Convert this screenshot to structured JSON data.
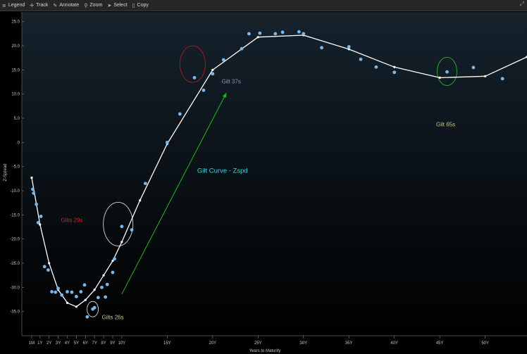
{
  "toolbar": {
    "items": [
      {
        "label": "Legend",
        "icon": "list-icon",
        "glyph": "≡"
      },
      {
        "label": "Track",
        "icon": "crosshair-icon",
        "glyph": "✛"
      },
      {
        "label": "Annotate",
        "icon": "pencil-icon",
        "glyph": "✎"
      },
      {
        "label": "Zoom",
        "icon": "magnifier-icon",
        "glyph": "⚲"
      },
      {
        "label": "Select",
        "icon": "cursor-icon",
        "glyph": "➤"
      },
      {
        "label": "Copy",
        "icon": "copy-icon",
        "glyph": "▯"
      }
    ]
  },
  "colors": {
    "background_top": "#15222c",
    "background_bottom": "#000000",
    "curve": "#ffffff",
    "points": "#7ab8ec",
    "arrow": "#1fb81f",
    "label_gilts29": "#d2282a",
    "label_gilt37": "#9a8cc4",
    "label_gilt65": "#c7c78a",
    "label_gilts26": "#c7c78a",
    "label_curve": "#3fd7e0",
    "circle_gilts29": "#d8d8d8",
    "circle_gilt37": "#b01a1a",
    "circle_gilt65": "#2fb12f",
    "circle_gilts26": "#d8d8d8"
  },
  "chart_data": {
    "type": "scatter",
    "title": "",
    "xlabel": "Years to Maturity",
    "ylabel": "Z-Spread",
    "xlim": [
      -1,
      54.6
    ],
    "ylim": [
      -40,
      27
    ],
    "grid": false,
    "x_tick_values": [
      0.083,
      1,
      2,
      3,
      4,
      5,
      6,
      7,
      8,
      9,
      10,
      15,
      20,
      25,
      30,
      35,
      40,
      45,
      50
    ],
    "x_tick_labels": [
      "1M",
      "1Y",
      "2Y",
      "3Y",
      "4Y",
      "5Y",
      "6Y",
      "7Y",
      "8Y",
      "9Y",
      "10Y",
      "15Y",
      "20Y",
      "25Y",
      "30Y",
      "35Y",
      "40Y",
      "45Y",
      "50Y"
    ],
    "y_tick_values": [
      25,
      20,
      15,
      10,
      5,
      0,
      -5,
      -10,
      -15,
      -20,
      -25,
      -30,
      -35
    ],
    "y_tick_labels": [
      "25.0",
      "20.0",
      "15.0",
      "10.0",
      "5.0",
      ".0",
      "-5.0",
      "-10.0",
      "-15.0",
      "-20.0",
      "-25.0",
      "-30.0",
      "-35.0"
    ],
    "series": [
      {
        "name": "Gilt Curve - Zspd",
        "kind": "line",
        "x": [
          0.083,
          0.6,
          1,
          2,
          3,
          4,
          5,
          6,
          7,
          8,
          9,
          10,
          12,
          15,
          20,
          25,
          30,
          35,
          40,
          45,
          50,
          54.6
        ],
        "y": [
          -7.3,
          -12.7,
          -17,
          -25,
          -30.5,
          -33.2,
          -34,
          -32.6,
          -30.5,
          -27.5,
          -24.5,
          -20.6,
          -12,
          -0.3,
          15,
          21.8,
          22.2,
          19.3,
          15.6,
          13.4,
          13.7,
          17.7
        ]
      },
      {
        "name": "Gilts",
        "kind": "scatter",
        "x": [
          0.2,
          0.3,
          0.6,
          0.8,
          1.1,
          1.5,
          1.9,
          2.3,
          2.7,
          3,
          3.4,
          4,
          4.5,
          5,
          5.5,
          5.9,
          6.2,
          6.8,
          7,
          7.4,
          7.8,
          8.2,
          8.4,
          9,
          9.2,
          10,
          11.1,
          12.6,
          15,
          16.4,
          18,
          19,
          20,
          21.2,
          23.2,
          24,
          25.2,
          26.9,
          27.7,
          29.5,
          30,
          32,
          35,
          36.3,
          38,
          40,
          45.8,
          48.7,
          51.9
        ],
        "y": [
          -9.7,
          -10.5,
          -12.8,
          -16.6,
          -15.3,
          -25.7,
          -26.4,
          -30.9,
          -31,
          -30.2,
          -31.6,
          -30.9,
          -31,
          -31.9,
          -30.9,
          -29.5,
          -36.1,
          -34.5,
          -34.2,
          -32.1,
          -30,
          -32,
          -29.4,
          -26.9,
          -24.1,
          -17.4,
          -18.1,
          -8.5,
          0,
          5.9,
          13.4,
          10.8,
          14.2,
          17.1,
          19.4,
          22.5,
          22.6,
          22.5,
          22.8,
          22.9,
          22.5,
          19.6,
          19.8,
          17.2,
          15.6,
          14.5,
          14.6,
          15.5,
          13.2
        ]
      }
    ],
    "annotations": [
      {
        "text": "Gilts 29s",
        "x": 3.3,
        "y": -16.5
      },
      {
        "text": "Gilt 37s",
        "x": 21,
        "y": 12.2
      },
      {
        "text": "Gilt 65s",
        "x": 44.6,
        "y": 3.3
      },
      {
        "text": "Gilts 26s",
        "x": 7.8,
        "y": -36.6
      },
      {
        "text": "Gilt Curve - Zspd",
        "x": 18.3,
        "y": -6.3
      }
    ],
    "highlight_circles": [
      {
        "label": "Gilts 29s",
        "x": 9.6,
        "y": -16.9
      },
      {
        "label": "Gilt 37s",
        "x": 17.8,
        "y": 16.2
      },
      {
        "label": "Gilt 65s",
        "x": 45.8,
        "y": 14.7
      },
      {
        "label": "Gilts 26s",
        "x": 6.8,
        "y": -34.5
      }
    ],
    "arrow": {
      "from": [
        10,
        -31.4
      ],
      "to": [
        21.5,
        10.2
      ]
    }
  }
}
